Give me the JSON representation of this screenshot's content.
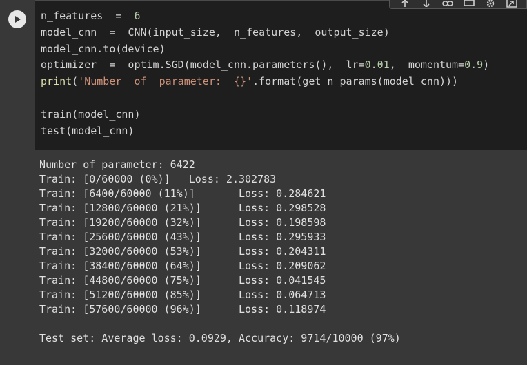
{
  "cell": {
    "code_lines": [
      [
        {
          "t": "n_features  =  ",
          "c": ""
        },
        {
          "t": "6",
          "c": "kw-num"
        }
      ],
      [
        {
          "t": "model_cnn  =  CNN(input_size,  n_features,  output_size)",
          "c": ""
        }
      ],
      [
        {
          "t": "model_cnn.to(device)",
          "c": ""
        }
      ],
      [
        {
          "t": "optimizer  =  optim.SGD(model_cnn.parameters(),  lr=",
          "c": ""
        },
        {
          "t": "0.01",
          "c": "kw-num"
        },
        {
          "t": ",  momentum=",
          "c": ""
        },
        {
          "t": "0.9",
          "c": "kw-num"
        },
        {
          "t": ")",
          "c": ""
        }
      ],
      [
        {
          "t": "print",
          "c": "kw-fn"
        },
        {
          "t": "(",
          "c": ""
        },
        {
          "t": "'Number  of  parameter:  {}'",
          "c": "kw-str"
        },
        {
          "t": ".format(get_n_params(model_cnn)))",
          "c": ""
        }
      ],
      [],
      [
        {
          "t": "train(model_cnn)",
          "c": ""
        }
      ],
      [
        {
          "t": "test(model_cnn)",
          "c": ""
        }
      ]
    ]
  },
  "output": {
    "lines": [
      "Number of parameter: 6422",
      "Train: [0/60000 (0%)]   Loss: 2.302783",
      "Train: [6400/60000 (11%)]       Loss: 0.284621",
      "Train: [12800/60000 (21%)]      Loss: 0.298528",
      "Train: [19200/60000 (32%)]      Loss: 0.198598",
      "Train: [25600/60000 (43%)]      Loss: 0.295933",
      "Train: [32000/60000 (53%)]      Loss: 0.204311",
      "Train: [38400/60000 (64%)]      Loss: 0.209062",
      "Train: [44800/60000 (75%)]      Loss: 0.041545",
      "Train: [51200/60000 (85%)]      Loss: 0.064713",
      "Train: [57600/60000 (96%)]      Loss: 0.118974",
      "",
      "Test set: Average loss: 0.0929, Accuracy: 9714/10000 (97%)"
    ]
  },
  "toolbar": {
    "icons": [
      "move-up-icon",
      "move-down-icon",
      "link-icon",
      "comment-icon",
      "gear-icon",
      "expand-icon"
    ]
  },
  "colors": {
    "editor_bg": "#1e1e1e",
    "output_bg": "#383838",
    "number": "#b5cea8",
    "string": "#ce9178",
    "function": "#dcdcaa"
  }
}
